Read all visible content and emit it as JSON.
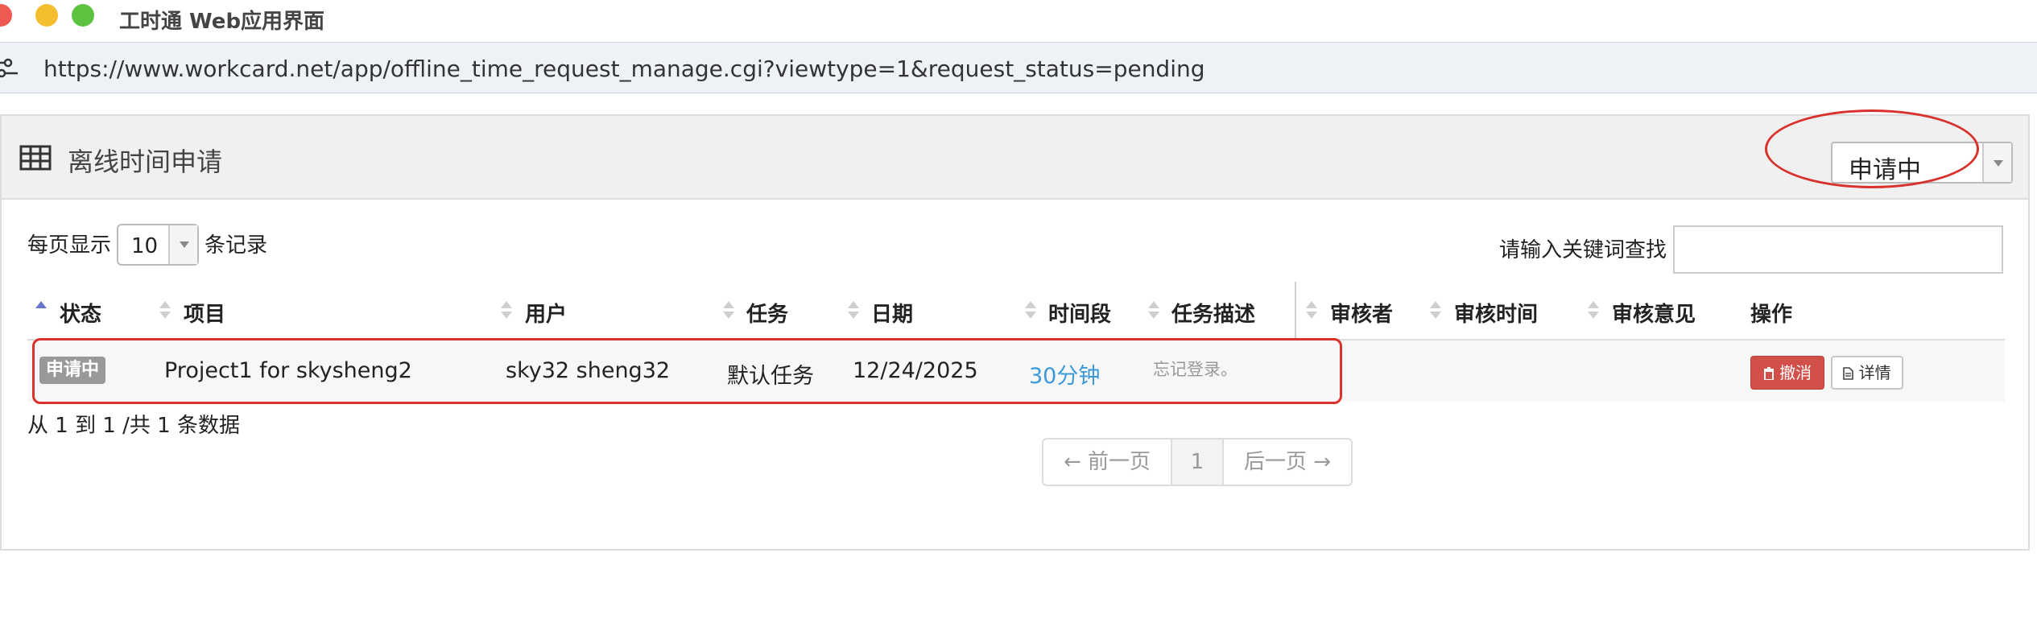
{
  "window": {
    "title": "工时通 Web应用界面"
  },
  "browser": {
    "url": "https://www.workcard.net/app/offline_time_request_manage.cgi?viewtype=1&request_status=pending"
  },
  "panel": {
    "title": "离线时间申请",
    "status_filter": "申请中"
  },
  "controls": {
    "page_length_prefix": "每页显示",
    "page_length_value": "10",
    "page_length_suffix": "条记录",
    "search_label": "请输入关键词查找",
    "search_value": ""
  },
  "table": {
    "columns": [
      "状态",
      "项目",
      "用户",
      "任务",
      "日期",
      "时间段",
      "任务描述",
      "审核者",
      "审核时间",
      "审核意见",
      "操作"
    ],
    "rows": [
      {
        "status": "申请中",
        "project": "Project1 for skysheng2",
        "user": "sky32 sheng32",
        "task": "默认任务",
        "date": "12/24/2025",
        "duration": "30分钟",
        "description": "忘记登录。",
        "reviewer": "",
        "review_time": "",
        "review_comment": "",
        "actions": {
          "cancel": "撤消",
          "detail": "详情"
        }
      }
    ]
  },
  "info": "从 1 到 1 /共 1 条数据",
  "pagination": {
    "prev": "← 前一页",
    "current": "1",
    "next": "后一页 →"
  },
  "colors": {
    "highlight": "#d9322c",
    "link": "#3a9ad9",
    "danger": "#d2504a",
    "badge": "#999999"
  }
}
